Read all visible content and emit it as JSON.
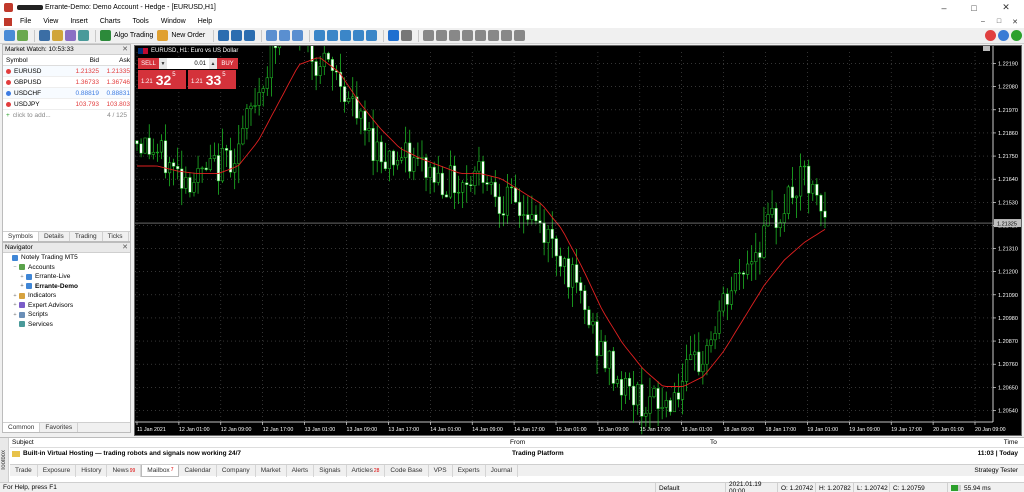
{
  "window": {
    "title": "Errante-Demo: Demo Account - Hedge - [EURUSD,H1]",
    "controls": [
      "–",
      "□",
      "✕"
    ]
  },
  "menu": {
    "items": [
      "File",
      "View",
      "Insert",
      "Charts",
      "Tools",
      "Window",
      "Help"
    ]
  },
  "toolbar": {
    "algo_label": "Algo Trading",
    "new_order_label": "New Order"
  },
  "market_watch": {
    "title": "Market Watch: 10:53:33",
    "columns": [
      "Symbol",
      "Bid",
      "Ask"
    ],
    "rows": [
      {
        "symbol": "EURUSD",
        "bid": "1.21325",
        "ask": "1.21335",
        "color": "#e23c3c"
      },
      {
        "symbol": "GBPUSD",
        "bid": "1.36733",
        "ask": "1.36746",
        "color": "#e23c3c"
      },
      {
        "symbol": "USDCHF",
        "bid": "0.88819",
        "ask": "0.88831",
        "color": "#3c7be2"
      },
      {
        "symbol": "USDJPY",
        "bid": "103.793",
        "ask": "103.803",
        "color": "#e23c3c"
      }
    ],
    "add_label": "click to add...",
    "count": "4 / 125",
    "tabs": [
      "Symbols",
      "Details",
      "Trading",
      "Ticks"
    ]
  },
  "navigator": {
    "title": "Navigator",
    "items": [
      {
        "label": "Notely Trading MT5",
        "depth": 0,
        "icon": "#3f86d6",
        "exp": ""
      },
      {
        "label": "Accounts",
        "depth": 1,
        "icon": "#5aa24a",
        "exp": "−"
      },
      {
        "label": "Errante-Live",
        "depth": 2,
        "icon": "#3f86d6",
        "exp": "+"
      },
      {
        "label": "Errante-Demo",
        "depth": 2,
        "icon": "#3f86d6",
        "exp": "+",
        "bold": true
      },
      {
        "label": "Indicators",
        "depth": 1,
        "icon": "#d6a23f",
        "exp": "+"
      },
      {
        "label": "Expert Advisors",
        "depth": 1,
        "icon": "#7a5cc8",
        "exp": "+"
      },
      {
        "label": "Scripts",
        "depth": 1,
        "icon": "#6a8fb8",
        "exp": "+"
      },
      {
        "label": "Services",
        "depth": 1,
        "icon": "#4a9a9a",
        "exp": ""
      }
    ],
    "tabs": [
      "Common",
      "Favorites"
    ]
  },
  "chart": {
    "header": "EURUSD, H1:  Euro vs US Dollar",
    "sell_label": "SELL",
    "buy_label": "BUY",
    "volume": "0.01",
    "sell_price": {
      "small": "1.21",
      "big": "32",
      "sup": "5"
    },
    "buy_price": {
      "small": "1.21",
      "big": "33",
      "sup": "5"
    },
    "current_price": "1.21325"
  },
  "chart_data": {
    "type": "candlestick",
    "symbol": "EURUSD",
    "timeframe": "H1",
    "title": "EURUSD, H1:  Euro vs US Dollar",
    "ylim": [
      1.2054,
      1.22
    ],
    "y_ticks": [
      "1.22190",
      "1.22080",
      "1.21970",
      "1.21860",
      "1.21750",
      "1.21640",
      "1.21530",
      "1.21420",
      "1.21310",
      "1.21200",
      "1.21090",
      "1.20980",
      "1.20870",
      "1.20760",
      "1.20650",
      "1.20540"
    ],
    "x_ticks": [
      "11 Jan 2021",
      "12 Jan 01:00",
      "12 Jan 09:00",
      "12 Jan 17:00",
      "13 Jan 01:00",
      "13 Jan 09:00",
      "13 Jan 17:00",
      "14 Jan 01:00",
      "14 Jan 09:00",
      "14 Jan 17:00",
      "15 Jan 01:00",
      "15 Jan 09:00",
      "15 Jan 17:00",
      "18 Jan 01:00",
      "18 Jan 09:00",
      "18 Jan 17:00",
      "19 Jan 01:00",
      "19 Jan 09:00",
      "19 Jan 17:00",
      "20 Jan 01:00",
      "20 Jan 09:00"
    ],
    "close_path": [
      1.2165,
      1.216,
      1.2152,
      1.215,
      1.2155,
      1.2162,
      1.2185,
      1.2205,
      1.221,
      1.2195,
      1.219,
      1.2172,
      1.216,
      1.2158,
      1.2155,
      1.215,
      1.2148,
      1.2155,
      1.2142,
      1.2138,
      1.213,
      1.212,
      1.21,
      1.208,
      1.2068,
      1.2062,
      1.206,
      1.207,
      1.208,
      1.21,
      1.2115,
      1.2128,
      1.214,
      1.215,
      1.2132
    ],
    "ma_path": [
      1.2155,
      1.2155,
      1.2153,
      1.2152,
      1.2152,
      1.2155,
      1.2165,
      1.218,
      1.2195,
      1.2198,
      1.2192,
      1.218,
      1.217,
      1.2162,
      1.2158,
      1.2155,
      1.2152,
      1.2152,
      1.215,
      1.2145,
      1.214,
      1.213,
      1.2115,
      1.2098,
      1.2085,
      1.2075,
      1.2068,
      1.2068,
      1.2072,
      1.2082,
      1.2095,
      1.2108,
      1.2118,
      1.2125,
      1.213
    ],
    "series": [
      {
        "name": "Moving Average",
        "color": "#e02020"
      }
    ],
    "up_color": "#22d02a",
    "down_color": "#ffffff",
    "grid": true
  },
  "toolbox": {
    "side_label": "Toolbox",
    "columns": [
      "Subject",
      "From",
      "To",
      "Time"
    ],
    "message": {
      "subject": "Built-in Virtual Hosting — trading robots and signals now working 24/7",
      "from": "Trading Platform",
      "to": "",
      "time": "11:03 | Today"
    },
    "tabs": [
      {
        "label": "Trade"
      },
      {
        "label": "Exposure"
      },
      {
        "label": "History"
      },
      {
        "label": "News",
        "badge": "99"
      },
      {
        "label": "Mailbox",
        "badge": "7",
        "active": true
      },
      {
        "label": "Calendar"
      },
      {
        "label": "Company"
      },
      {
        "label": "Market"
      },
      {
        "label": "Alerts"
      },
      {
        "label": "Signals"
      },
      {
        "label": "Articles",
        "badge": "28"
      },
      {
        "label": "Code Base"
      },
      {
        "label": "VPS"
      },
      {
        "label": "Experts"
      },
      {
        "label": "Journal"
      }
    ],
    "strategy_tester": "Strategy Tester"
  },
  "status": {
    "help": "For Help, press F1",
    "profile": "Default",
    "datetime": "2021.01.19 00:00",
    "open": "O: 1.20742",
    "high": "H: 1.20782",
    "low": "L: 1.20742",
    "close": "C: 1.20759",
    "connection": "55.94 ms"
  }
}
